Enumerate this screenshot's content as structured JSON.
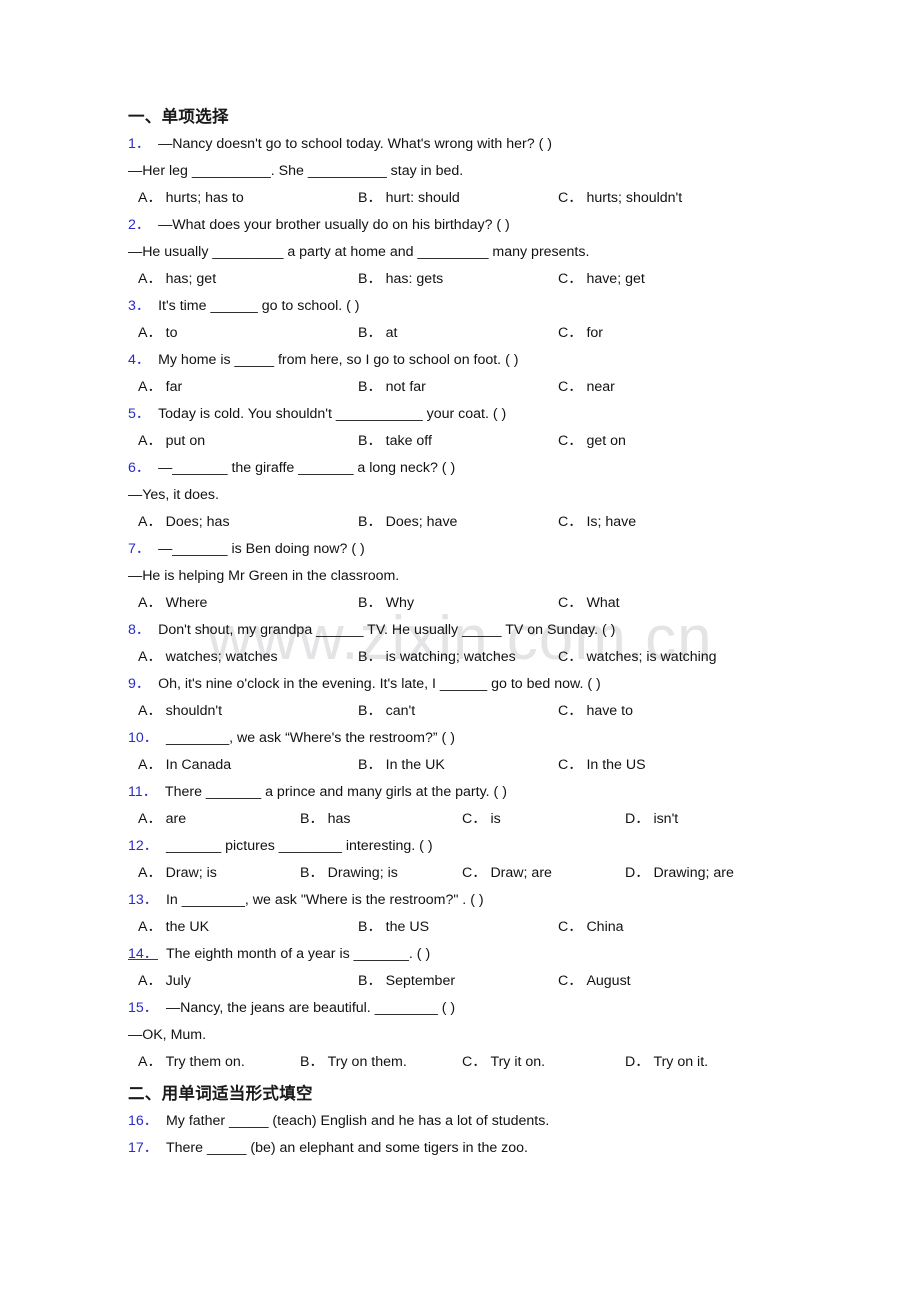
{
  "watermark": "www.zixin.com.cn",
  "sections": [
    {
      "heading": "一、单项选择",
      "questions": [
        {
          "number": "1．",
          "stem": "—Nancy doesn't go to school today. What's wrong with her? (   )",
          "continuation": "—Her leg __________. She __________ stay in bed.",
          "options": [
            "hurts; has to",
            "hurt: should",
            "hurts; shouldn't"
          ],
          "letters": [
            "A．",
            "B．",
            "C．"
          ]
        },
        {
          "number": "2．",
          "stem": "—What does your brother usually do on his birthday? (   )",
          "continuation": "—He usually _________ a party at home and _________ many presents.",
          "options": [
            "has; get",
            "has: gets",
            "have; get"
          ],
          "letters": [
            "A．",
            "B．",
            "C．"
          ]
        },
        {
          "number": "3．",
          "stem": "It's time ______ go to school. (   )",
          "continuation": "",
          "options": [
            "to",
            "at",
            "for"
          ],
          "letters": [
            "A．",
            "B．",
            "C．"
          ]
        },
        {
          "number": "4．",
          "stem": "My home is _____ from here, so I go to school on foot. (   )",
          "continuation": "",
          "options": [
            "far",
            "not far",
            "near"
          ],
          "letters": [
            "A．",
            "B．",
            "C．"
          ]
        },
        {
          "number": "5．",
          "stem": "Today is cold. You shouldn't ___________ your coat. ( )",
          "continuation": "",
          "options": [
            "put on",
            "take off",
            "get on"
          ],
          "letters": [
            "A．",
            "B．",
            "C．"
          ]
        },
        {
          "number": "6．",
          "stem": "—_______ the giraffe _______ a long neck? (  )",
          "continuation": "—Yes, it does.",
          "options": [
            "Does; has",
            "Does; have",
            "Is; have"
          ],
          "letters": [
            "A．",
            "B．",
            "C．"
          ]
        },
        {
          "number": "7．",
          "stem": "—_______ is Ben doing now? (  )",
          "continuation": "—He is helping Mr Green in the classroom.",
          "options": [
            "Where",
            "Why",
            "What"
          ],
          "letters": [
            "A．",
            "B．",
            "C．"
          ]
        },
        {
          "number": "8．",
          "stem": "Don't shout, my grandpa ______ TV. He usually _____ TV on Sunday. ( )",
          "continuation": "",
          "options": [
            "watches; watches",
            "is watching; watches",
            "watches; is watching"
          ],
          "letters": [
            "A．",
            "B．",
            "C．"
          ]
        },
        {
          "number": "9．",
          "stem": "Oh, it's nine o'clock in the evening. It's late, I ______ go to bed now. ( )",
          "continuation": "",
          "options": [
            "shouldn't",
            "can't",
            "have to"
          ],
          "letters": [
            "A．",
            "B．",
            "C．"
          ]
        },
        {
          "number": "10．",
          "stem": "________, we ask “Where's the restroom?” (  )",
          "continuation": "",
          "options": [
            "In Canada",
            "In the UK",
            "In the US"
          ],
          "letters": [
            "A．",
            "B．",
            "C．"
          ]
        },
        {
          "number": "11．",
          "stem": "There _______ a prince and many girls at the party. (  )",
          "continuation": "",
          "options": [
            "are",
            "has",
            "is",
            "isn't"
          ],
          "letters": [
            "A．",
            "B．",
            "C．",
            "D．"
          ]
        },
        {
          "number": "12．",
          "stem": "_______ pictures ________ interesting. (  )",
          "continuation": "",
          "options": [
            "Draw; is",
            "Drawing; is",
            "Draw; are",
            "Drawing; are"
          ],
          "letters": [
            "A．",
            "B．",
            "C．",
            "D．"
          ]
        },
        {
          "number": "13．",
          "stem": "In ________, we ask \"Where is the restroom?\" . (   )",
          "continuation": "",
          "options": [
            "the UK",
            "the US",
            "China"
          ],
          "letters": [
            "A．",
            "B．",
            "C．"
          ]
        },
        {
          "number": "14．",
          "stem": "The eighth month of a year is _______. ( )",
          "continuation": "",
          "options": [
            "July",
            "September",
            "August"
          ],
          "letters": [
            "A．",
            "B．",
            "C．"
          ],
          "underlined_number": true
        },
        {
          "number": "15．",
          "stem": "—Nancy, the jeans are beautiful. ________ ( )",
          "continuation": "—OK, Mum.",
          "options": [
            "Try them on.",
            "Try on them.",
            "Try it on.",
            "Try on it."
          ],
          "letters": [
            "A．",
            "B．",
            "C．",
            "D．"
          ]
        }
      ]
    },
    {
      "heading": "二、用单词适当形式填空",
      "questions": [
        {
          "number": "16．",
          "stem": "My father _____ (teach) English and he has a lot of students.",
          "continuation": "",
          "options": [],
          "letters": []
        },
        {
          "number": "17．",
          "stem": "There _____ (be) an elephant and some tigers in the zoo.",
          "continuation": "",
          "options": [],
          "letters": []
        }
      ]
    }
  ]
}
